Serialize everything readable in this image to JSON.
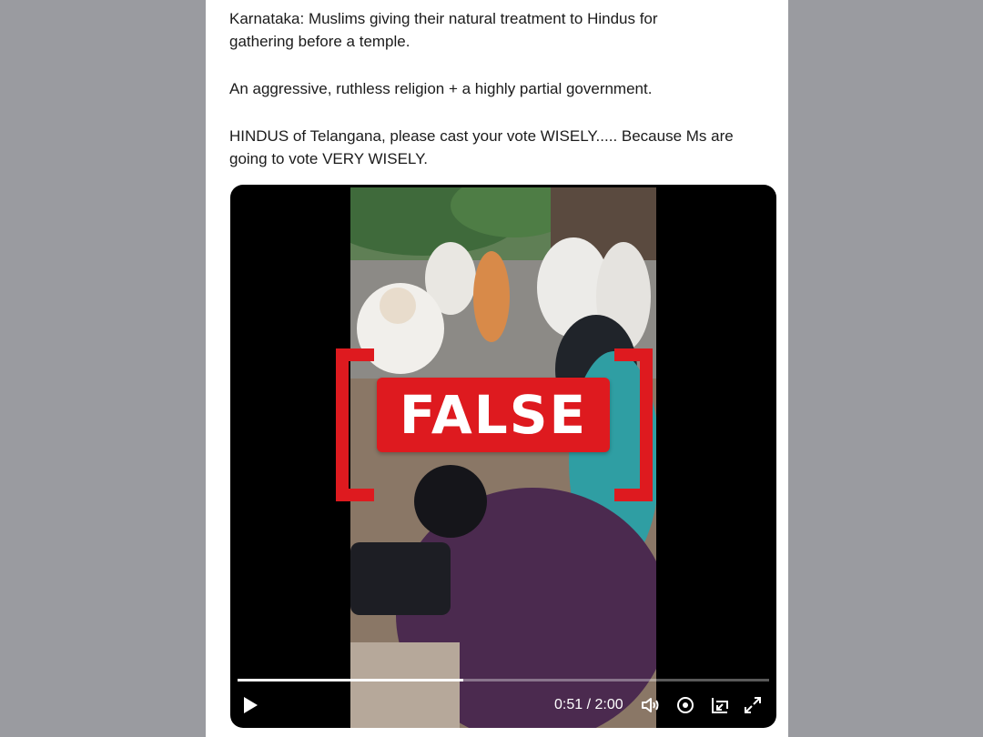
{
  "tweet": {
    "paragraphs": [
      "Karnataka:  Muslims giving their natural treatment to Hindus for\ngathering before a temple.",
      "An aggressive, ruthless religion + a highly partial government.",
      "HINDUS of Telangana, please cast your vote WISELY..... Because Ms are\ngoing to vote VERY WISELY."
    ]
  },
  "overlay": {
    "stamp_label": "FALSE",
    "stamp_color": "#de1a1f"
  },
  "video": {
    "current_time": "0:51",
    "duration": "2:00",
    "time_display": "0:51 / 2:00",
    "progress_fraction": 0.425,
    "icons": [
      "play-icon",
      "volume-icon",
      "settings-icon",
      "picture-in-picture-icon",
      "fullscreen-icon"
    ]
  }
}
